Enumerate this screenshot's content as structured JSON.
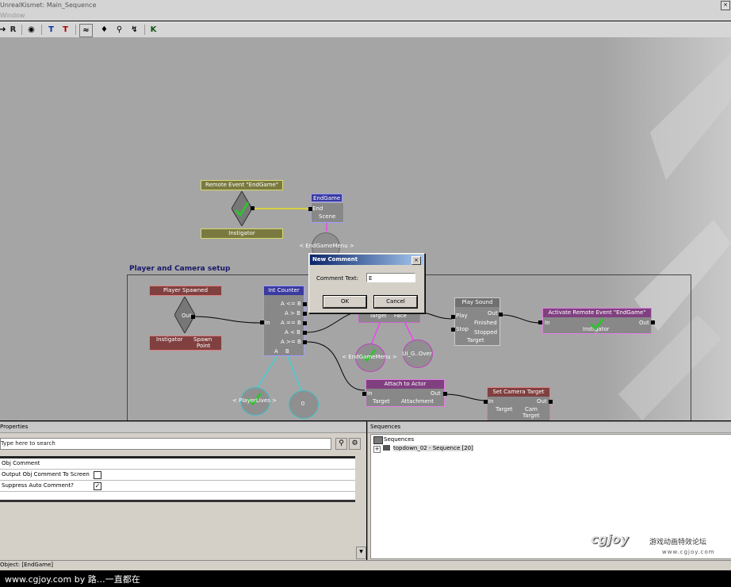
{
  "window": {
    "title": "UnrealKismet: Main_Sequence",
    "menu": "Window"
  },
  "toolbar": {
    "icons": [
      "arrow-icon",
      "refresh-icon",
      "eye-icon",
      "flag-T-icon",
      "flag-T2-icon",
      "curve-icon",
      "bulb-icon",
      "zoom-icon",
      "link-icon",
      "K-icon"
    ]
  },
  "canvas": {
    "group_label": "Player and Camera setup",
    "nodes": {
      "remote_event": {
        "title": "Remote Event \"EndGame\"",
        "sub": "Instigator"
      },
      "endgame": {
        "title": "EndGame",
        "ports": [
          "End",
          "Scene"
        ]
      },
      "endgame_menu_top": "< EndGameMenu >",
      "player_spawned": {
        "title": "Player Spawned",
        "out": "Out",
        "sub1": "Instigator",
        "sub2": "Spawn",
        "sub3": "Point"
      },
      "int_counter": {
        "title": "Int Counter",
        "in": "In",
        "outs": [
          "A <= B",
          "A > B",
          "A == B",
          "A < B",
          "A >= B"
        ],
        "vars": [
          "A",
          "B"
        ]
      },
      "partial_node": {
        "ports": [
          "Target",
          "Face"
        ]
      },
      "endgame_menu": "< EndGameMenu >",
      "ui_gover": "UI_G..Over",
      "player_lives": "< PlayerLives >",
      "zero": "0",
      "play_sound": {
        "title": "Play Sound",
        "ports": [
          "Play",
          "Stop",
          "Out",
          "Finished",
          "Stopped",
          "Target"
        ]
      },
      "activate_remote": {
        "title": "Activate Remote Event \"EndGame\"",
        "in": "In",
        "out": "Out",
        "sub": "Instigator"
      },
      "attach": {
        "title": "Attach to Actor",
        "in": "In",
        "out": "Out",
        "sub1": "Target",
        "sub2": "Attachment"
      },
      "set_camera": {
        "title": "Set Camera Target",
        "in": "In",
        "out": "Out",
        "sub1": "Target",
        "sub2": "Cam",
        "sub3": "Target"
      }
    }
  },
  "dialog": {
    "title": "New Comment",
    "close": "×",
    "label": "Comment Text:",
    "value": "E",
    "ok": "OK",
    "cancel": "Cancel"
  },
  "properties": {
    "header": "Properties",
    "search_placeholder": "Type here to search",
    "rows": [
      {
        "key": "Obj Comment",
        "checkbox": null
      },
      {
        "key": "Output Obj Comment To Screen",
        "checkbox": false
      },
      {
        "key": "Suppress Auto Comment?",
        "checkbox": true
      }
    ],
    "scroll_down": "▼"
  },
  "sequences": {
    "header": "Sequences",
    "root": "Sequences",
    "child": "topdown_02 - Sequence [20]",
    "expand": "+"
  },
  "status": {
    "text": "Object: [EndGame]"
  },
  "footer": {
    "text": "www.cgjoy.com by 路…一直都在"
  },
  "watermark": {
    "logo": "cgjoy",
    "cn": "游戏动画特效论坛",
    "url": "www.cgjoy.com"
  }
}
